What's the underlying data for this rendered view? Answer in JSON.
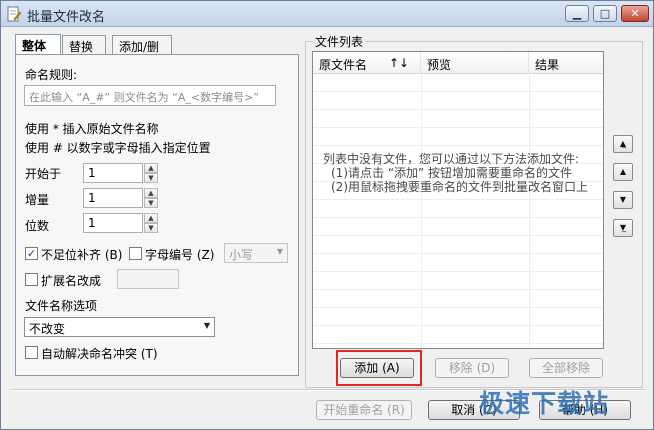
{
  "window": {
    "title": "批量文件改名",
    "controls": [
      "minimize",
      "maximize",
      "close"
    ]
  },
  "tabs": [
    {
      "label": "整体",
      "active": true
    },
    {
      "label": "替换",
      "active": false
    },
    {
      "label": "添加/删除",
      "active": false
    }
  ],
  "naming": {
    "rule_label": "命名规则:",
    "rule_placeholder": "在此输入 “A_#” 则文件名为 “A_<数字编号>”",
    "hint1": "使用 * 插入原始文件名称",
    "hint2": "使用 # 以数字或字母插入指定位置",
    "start_label": "开始于",
    "start_value": "1",
    "step_label": "增量",
    "step_value": "1",
    "digits_label": "位数",
    "digits_value": "1",
    "pad_label": "不足位补齐 (B)",
    "pad_checked": true,
    "alpha_label": "字母编号 (Z)",
    "alpha_checked": false,
    "case_value": "小写",
    "ext_label": "扩展名改成",
    "ext_checked": false,
    "name_options_label": "文件名称选项",
    "name_option_value": "不改变",
    "auto_resolve_label": "自动解决命名冲突 (T)",
    "auto_resolve_checked": false
  },
  "file_list": {
    "group_title": "文件列表",
    "columns": [
      "原文件名",
      "预览",
      "结果"
    ],
    "sort_indicator": "↑↓",
    "empty_line1": "列表中没有文件，您可以通过以下方法添加文件:",
    "empty_line2": "(1)请点击 “添加” 按钮增加需要重命名的文件",
    "empty_line3": "(2)用鼠标拖拽要重命名的文件到批量改名窗口上",
    "side_buttons": [
      "move-top",
      "move-up",
      "move-down",
      "move-bottom"
    ],
    "add_label": "添加 (A)",
    "remove_label": "移除 (D)",
    "remove_all_label": "全部移除"
  },
  "footer": {
    "start_label": "开始重命名 (R)",
    "cancel_label": "取消 (C)",
    "help_label": "帮助 (H)"
  },
  "watermark": "极速下载站",
  "colors": {
    "highlight": "#e0282a",
    "watermark": "#2f6fb3"
  }
}
